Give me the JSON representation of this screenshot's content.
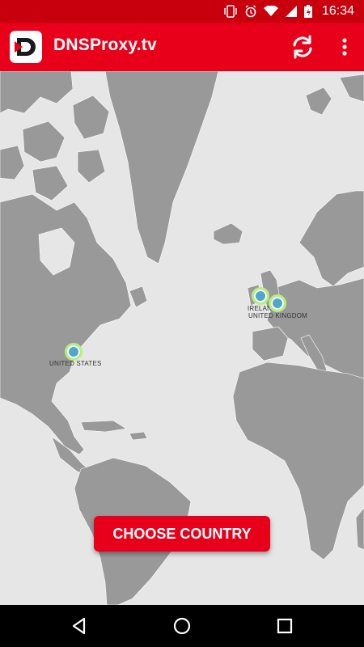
{
  "status_bar": {
    "time": "16:34"
  },
  "app_bar": {
    "title": "DNSProxy.tv"
  },
  "map": {
    "markers": [
      {
        "label": "UNITED STATES"
      },
      {
        "label": "IRELAND"
      },
      {
        "label": "UNITED KINGDOM"
      }
    ]
  },
  "actions": {
    "choose_country": "CHOOSE COUNTRY"
  },
  "colors": {
    "brand": "#e8001a",
    "status_bar": "#c8000d",
    "land": "#999999",
    "sea": "#e6e6e6",
    "marker": "#4fa8c9",
    "marker_ring": "#b6f07a"
  }
}
